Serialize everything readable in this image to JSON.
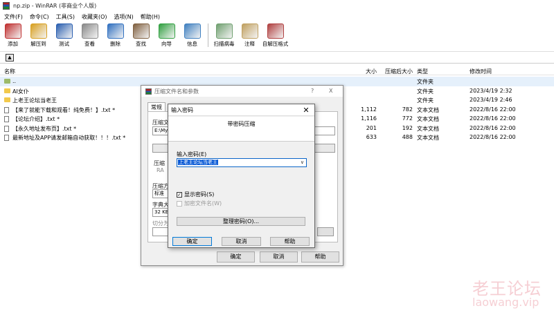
{
  "window": {
    "title": "np.zip - WinRAR (非商业个人版)"
  },
  "menu": [
    "文件(F)",
    "命令(C)",
    "工具(S)",
    "收藏夹(O)",
    "选项(N)",
    "帮助(H)"
  ],
  "toolbar": [
    {
      "label": "添加",
      "icon": "add-books-icon",
      "color": "#c03030"
    },
    {
      "label": "解压到",
      "icon": "extract-folder-icon",
      "color": "#d8a020"
    },
    {
      "label": "测试",
      "icon": "test-book-icon",
      "color": "#2a5fb0"
    },
    {
      "label": "查看",
      "icon": "view-glasses-icon",
      "color": "#888888"
    },
    {
      "label": "删除",
      "icon": "delete-icon",
      "color": "#3070c0"
    },
    {
      "label": "查找",
      "icon": "find-binoculars-icon",
      "color": "#806040"
    },
    {
      "label": "向导",
      "icon": "wizard-icon",
      "color": "#30a040"
    },
    {
      "label": "信息",
      "icon": "info-icon",
      "color": "#4080c0"
    },
    {
      "label": "扫描病毒",
      "icon": "scan-virus-icon",
      "color": "#70a070"
    },
    {
      "label": "注释",
      "icon": "comment-pen-icon",
      "color": "#c0a060"
    },
    {
      "label": "自解压格式",
      "icon": "sfx-icon",
      "color": "#b04040"
    }
  ],
  "columns": {
    "name": "名称",
    "size": "大小",
    "packed": "压缩后大小",
    "type": "类型",
    "modified": "修改时间"
  },
  "files": [
    {
      "name": "..",
      "size": "",
      "packed": "",
      "type": "文件夹",
      "modified": "",
      "kind": "up"
    },
    {
      "name": "AI女仆",
      "size": "",
      "packed": "",
      "type": "文件夹",
      "modified": "2023/4/19 2:32",
      "kind": "folder"
    },
    {
      "name": "上老王论坛当老王",
      "size": "",
      "packed": "",
      "type": "文件夹",
      "modified": "2023/4/19 2:46",
      "kind": "folder"
    },
    {
      "name": "【来了就能下载和观看！纯免费！】.txt *",
      "size": "1,112",
      "packed": "782",
      "type": "文本文档",
      "modified": "2022/8/16 22:00",
      "kind": "file"
    },
    {
      "name": "【论坛介绍】.txt *",
      "size": "1,116",
      "packed": "772",
      "type": "文本文档",
      "modified": "2022/8/16 22:00",
      "kind": "file"
    },
    {
      "name": "【永久地址发布页】.txt *",
      "size": "201",
      "packed": "192",
      "type": "文本文档",
      "modified": "2022/8/16 22:00",
      "kind": "file"
    },
    {
      "name": "最新地址及APP请发邮箱自动获取！！！.txt *",
      "size": "633",
      "packed": "488",
      "type": "文本文档",
      "modified": "2022/8/16 22:00",
      "kind": "file"
    }
  ],
  "archive_dialog": {
    "title": "压缩文件名和参数",
    "help": "?",
    "close": "X",
    "tab": "常规",
    "label_name": "压缩文",
    "name_value": "E:\\My",
    "label_compress": "压缩",
    "radio_partial": "RA",
    "label_method": "压缩方",
    "method_value": "标准",
    "label_dict": "字典大",
    "dict_value": "32 KB",
    "label_split": "切分为",
    "ok": "确定",
    "cancel": "取消",
    "help_btn": "帮助"
  },
  "password_dialog": {
    "title": "输入密码",
    "close": "✕",
    "heading": "带密码压缩",
    "label": "输入密码(E)",
    "value": "上老王论坛当老王",
    "show_password": "显示密码(S)",
    "encrypt_names": "加密文件名(W)",
    "organize": "整理密码(O)...",
    "ok": "确定",
    "cancel": "取消",
    "help": "帮助"
  },
  "watermark": {
    "text": "老王论坛",
    "url": "laowang.vip"
  }
}
